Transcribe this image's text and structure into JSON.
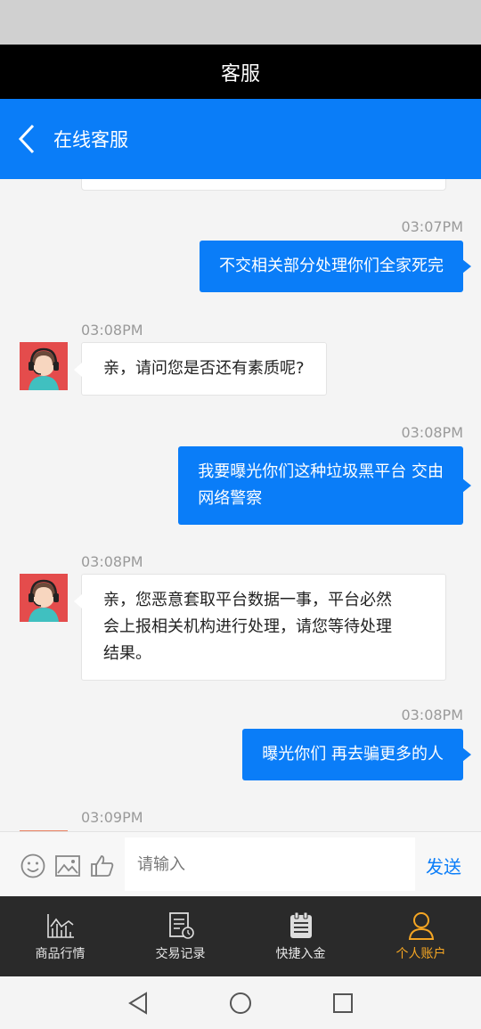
{
  "window_title": "客服",
  "nav": {
    "title": "在线客服"
  },
  "messages": [
    {
      "side": "out",
      "time": "03:07PM",
      "text": [
        "不交相关部分处理你们全家死完"
      ]
    },
    {
      "side": "in",
      "time": "03:08PM",
      "text": [
        "亲，请问您是否还有素质呢?"
      ]
    },
    {
      "side": "out",
      "time": "03:08PM",
      "text": [
        "我要曝光你们这种垃圾黑平台 交由",
        "网络警察"
      ]
    },
    {
      "side": "in",
      "time": "03:08PM",
      "text": [
        "亲，您恶意套取平台数据一事，平台必然",
        "会上报相关机构进行处理，请您等待处理",
        "结果。"
      ]
    },
    {
      "side": "out",
      "time": "03:08PM",
      "text": [
        "曝光你们 再去骗更多的人"
      ]
    },
    {
      "side": "in",
      "time": "03:09PM",
      "text": []
    }
  ],
  "input": {
    "placeholder": "请输入",
    "send_label": "发送"
  },
  "tabs": [
    {
      "label": "商品行情",
      "icon": "chart-icon",
      "active": false
    },
    {
      "label": "交易记录",
      "icon": "record-icon",
      "active": false
    },
    {
      "label": "快捷入金",
      "icon": "clipboard-icon",
      "active": false
    },
    {
      "label": "个人账户",
      "icon": "person-icon",
      "active": true
    }
  ],
  "colors": {
    "accent": "#0a7df8",
    "active_tab": "#f5a623"
  }
}
